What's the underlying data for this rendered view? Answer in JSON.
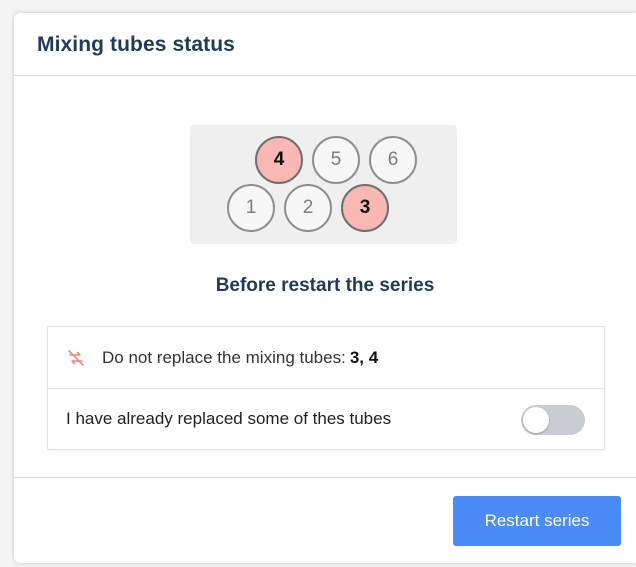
{
  "dialog": {
    "title": "Mixing tubes status",
    "subtitle": "Before restart the series"
  },
  "tubes": [
    {
      "label": "4",
      "flagged": true
    },
    {
      "label": "5",
      "flagged": false
    },
    {
      "label": "6",
      "flagged": false
    },
    {
      "label": "1",
      "flagged": false
    },
    {
      "label": "2",
      "flagged": false
    },
    {
      "label": "3",
      "flagged": true
    }
  ],
  "warning": {
    "icon": "no-swap-icon",
    "text": "Do not replace the mixing tubes:",
    "tubes": "3, 4"
  },
  "replaced_toggle": {
    "label": "I have already replaced some of thes tubes",
    "on": false
  },
  "footer": {
    "restart_label": "Restart series"
  },
  "colors": {
    "accent": "#4a8bf5",
    "flagged_tube": "#f9b8b3",
    "title": "#1f3b5a",
    "warning_icon": "#f2867e"
  }
}
